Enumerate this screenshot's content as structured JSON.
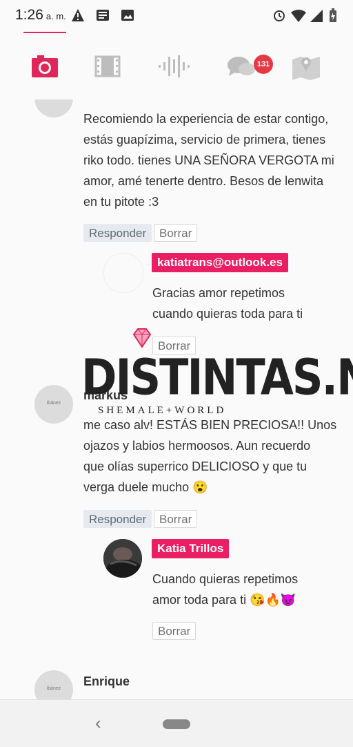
{
  "status_bar": {
    "time": "1:26",
    "ampm": "a. m.",
    "icons_left": [
      "warning-icon",
      "news-icon",
      "image-icon"
    ],
    "icons_right": [
      "alarm-icon",
      "wifi-icon",
      "signal-icon",
      "battery-icon"
    ]
  },
  "tabs": {
    "items": [
      {
        "name": "camera-icon",
        "active": true
      },
      {
        "name": "film-icon",
        "active": false
      },
      {
        "name": "audio-icon",
        "active": false
      },
      {
        "name": "chat-icon",
        "active": false
      },
      {
        "name": "map-icon",
        "active": false
      }
    ],
    "chat_badge": "131",
    "accent": "#e0265a"
  },
  "comments": [
    {
      "author": "",
      "text_lines": [
        "Recomiendo la experiencia de estar contigo,",
        "estás guapízima, servicio de primera, tienes",
        "riko todo. tienes UNA SEÑORA VERGOTA mi",
        "amor, amé tenerte dentro. Besos de lenwita",
        "en tu pitote :3"
      ],
      "reply_label": "Responder",
      "delete_label": "Borrar",
      "reply": {
        "author_tag": "katiatrans@outlook.es",
        "text_lines": [
          "Gracias amor repetimos",
          "cuando quieras toda para ti"
        ],
        "delete_label": "Borrar"
      }
    },
    {
      "author": "markus",
      "avatar_text": "ibánez",
      "text_lines": [
        "me caso alv! ESTÁS BIEN PRECIOSA!! Unos",
        "ojazos y labios hermoosos. Aun recuerdo",
        "que olías superrico DELICIOSO y que tu",
        "verga duele mucho 😮"
      ],
      "reply_label": "Responder",
      "delete_label": "Borrar",
      "reply": {
        "author_tag": "Katia Trillos",
        "text_lines": [
          "Cuando quieras repetimos",
          "amor toda para ti 😘🔥😈"
        ],
        "delete_label": "Borrar"
      }
    },
    {
      "author": "Enrique",
      "avatar_text": "ibánez"
    }
  ],
  "watermark": {
    "title": "DISTINTAS.NET",
    "subtitle": "SHEMALE+WORLD"
  }
}
